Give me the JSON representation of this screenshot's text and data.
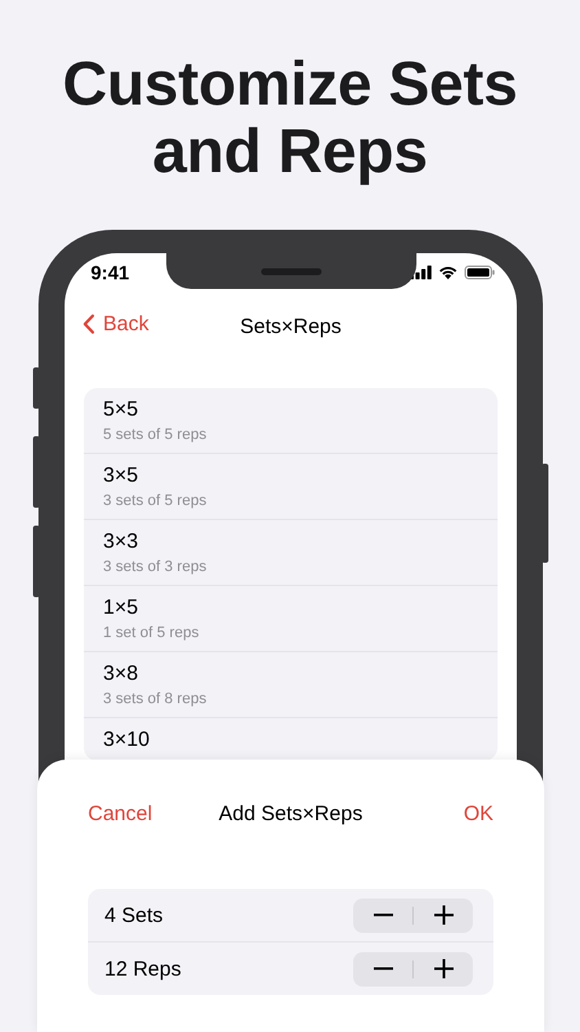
{
  "headline_lines": [
    "Customize Sets",
    "and Reps"
  ],
  "status_bar": {
    "time": "9:41"
  },
  "nav": {
    "back": "Back",
    "title": "Sets×Reps"
  },
  "presets": [
    {
      "title": "5×5",
      "subtitle": "5 sets of 5 reps"
    },
    {
      "title": "3×5",
      "subtitle": "3 sets of 5 reps"
    },
    {
      "title": "3×3",
      "subtitle": "3 sets of 3 reps"
    },
    {
      "title": "1×5",
      "subtitle": "1 set of 5 reps"
    },
    {
      "title": "3×8",
      "subtitle": "3 sets of 8 reps"
    },
    {
      "title": "3×10"
    }
  ],
  "sheet": {
    "cancel": "Cancel",
    "title": "Add Sets×Reps",
    "ok": "OK",
    "steppers": [
      {
        "label": "4 Sets"
      },
      {
        "label": "12 Reps"
      }
    ]
  }
}
